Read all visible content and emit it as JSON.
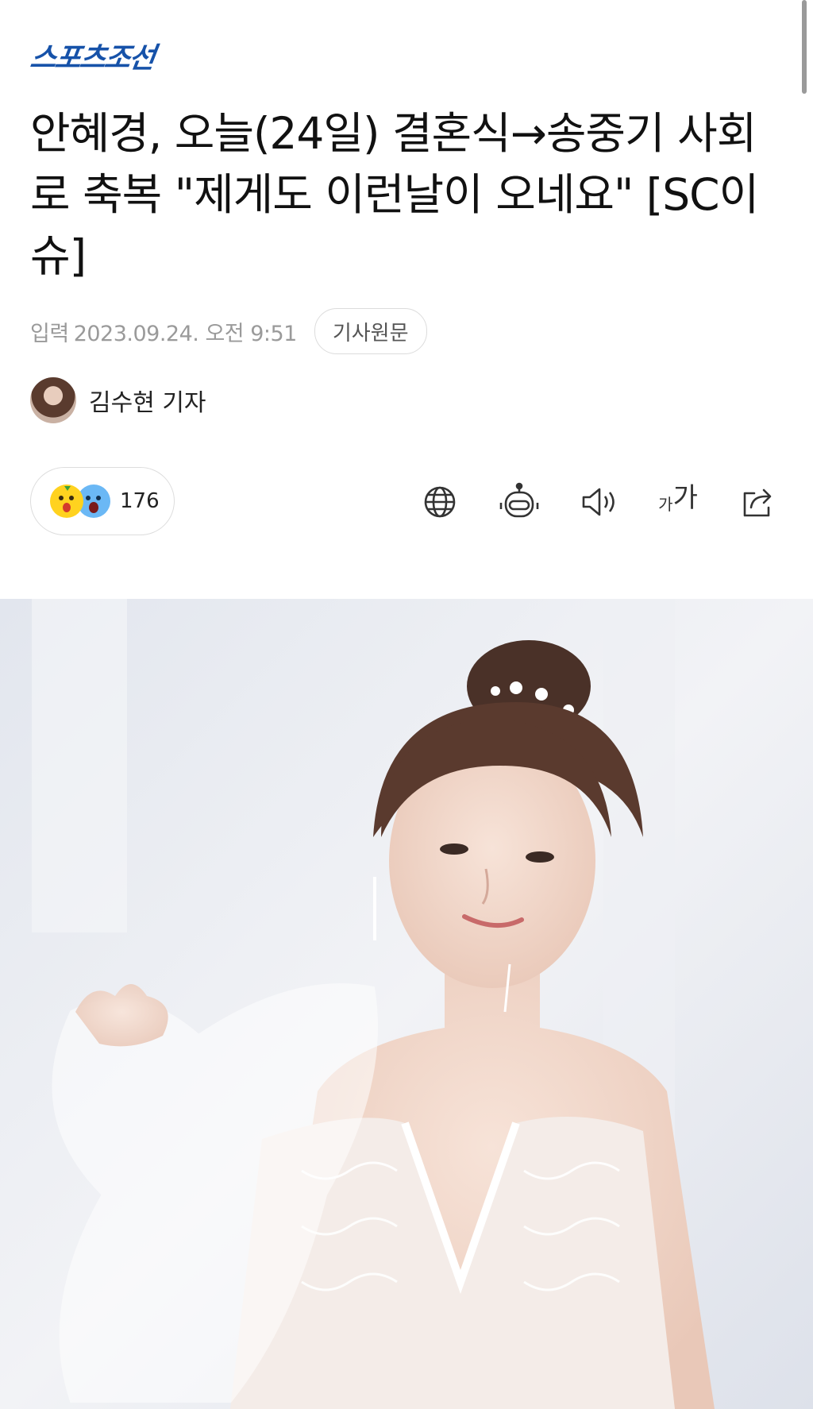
{
  "brand": {
    "logo_text": "스포츠조선",
    "color": "#1652a9"
  },
  "article": {
    "headline": "안혜경, 오늘(24일) 결혼식→송중기 사회로 축복 \"제게도 이런날이 오네요\" [SC이슈]",
    "published_label": "입력",
    "published_value": "2023.09.24. 오전 9:51",
    "original_link_label": "기사원문",
    "reporter_name": "김수현 기자"
  },
  "reactions": {
    "icons": [
      "surprised-emoji-icon",
      "shocked-emoji-icon"
    ],
    "count": "176"
  },
  "toolbar": {
    "icons": [
      "globe-icon",
      "robot-icon",
      "speaker-icon",
      "font-size-icon",
      "share-icon"
    ],
    "font_size_small": "가",
    "font_size_big": "가"
  },
  "colors": {
    "text_primary": "#111111",
    "text_meta": "#9a9a9a",
    "border": "#dddddd"
  }
}
